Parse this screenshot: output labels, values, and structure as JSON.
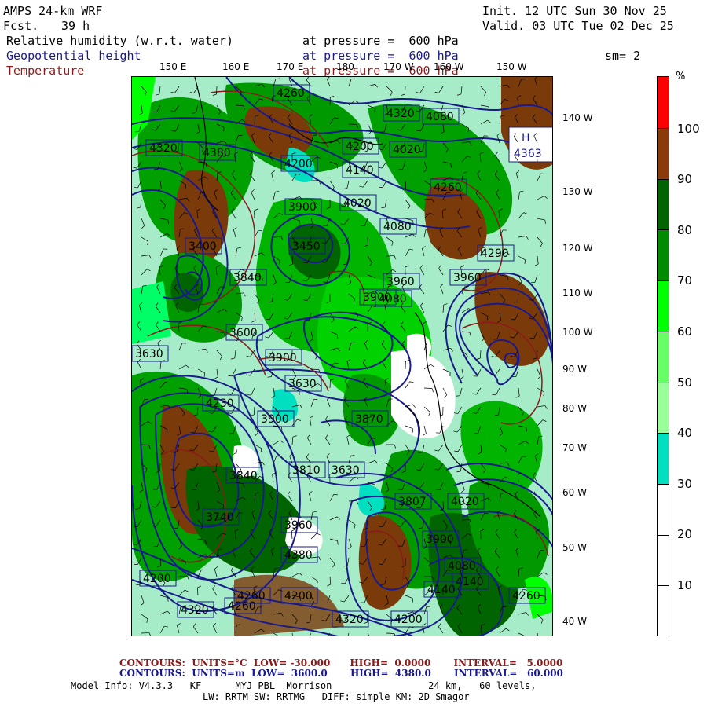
{
  "header": {
    "model": "AMPS 24-km WRF",
    "fcst_label": "Fcst.",
    "fcst_value": "39 h",
    "init": "Init. 12 UTC Sun 30 Nov 25",
    "valid": "Valid. 03 UTC Tue 02 Dec 25",
    "fields": [
      {
        "name": "Relative humidity (w.r.t. water)",
        "level": "at pressure =  600 hPa",
        "color": "#000000"
      },
      {
        "name": "Geopotential height",
        "level": "at pressure =  600 hPa",
        "color": "#1a1a8c"
      },
      {
        "name": "Temperature",
        "level": "at pressure =  600 hPa",
        "color": "#8b1a1a"
      }
    ],
    "smoothing": "sm= 2"
  },
  "axes": {
    "top_lon_labels": [
      "150 E",
      "160 E",
      "170 E",
      "180",
      "170 W",
      "160 W",
      "150 W"
    ],
    "right_lat_labels": [
      "140 W",
      "130 W",
      "120 W",
      "110 W",
      "100 W",
      "90 W",
      "80 W",
      "70 W",
      "60 W",
      "50 W",
      "40 W"
    ]
  },
  "map_labels": {
    "height_boxes": [
      "4320",
      "4380",
      "4260",
      "4200",
      "4140",
      "4020",
      "4080",
      "4363",
      "4320",
      "4200",
      "4290",
      "3900",
      "4020",
      "4080",
      "4260",
      "3400",
      "3450",
      "3960",
      "4080",
      "3840",
      "3960",
      "3900",
      "3630",
      "3600",
      "3900",
      "3630",
      "4230",
      "3900",
      "3870",
      "3840",
      "3810",
      "3630",
      "3740",
      "3807",
      "3960",
      "3900",
      "4080",
      "4140",
      "4140",
      "4320",
      "4380",
      "4200",
      "4260",
      "4260",
      "4200",
      "4320",
      "4200",
      "4260",
      "4020"
    ],
    "high_marker": "H",
    "high_value": "4363"
  },
  "colorbar": {
    "unit": "%",
    "ticks": [
      "100",
      "90",
      "80",
      "70",
      "60",
      "50",
      "40",
      "30",
      "20",
      "10"
    ],
    "segments": [
      {
        "color": "#ff0000"
      },
      {
        "color": "#8b3a0a"
      },
      {
        "color": "#006400"
      },
      {
        "color": "#008c00"
      },
      {
        "color": "#00ff00"
      },
      {
        "color": "#66ff66"
      },
      {
        "color": "#99ff99"
      },
      {
        "color": "#00e0c0"
      },
      {
        "color": "#ffffff"
      },
      {
        "color": "#ffffff"
      },
      {
        "color": "#ffffff"
      }
    ]
  },
  "footer": {
    "temp_contours": "CONTOURS:  UNITS=°C  LOW= -30.000      HIGH=  0.0000       INTERVAL=   5.0000",
    "temp_color": "#8b1a1a",
    "hgt_contours": "CONTOURS:  UNITS=m  LOW=  3600.0       HIGH=  4380.0       INTERVAL=   60.000",
    "hgt_color": "#1a1a8c",
    "model_info": "Model Info: V4.3.3   KF      MYJ PBL  Morrison                 24 km,   60 levels,",
    "model_info2": "LW: RRTM SW: RRTMG   DIFF: simple KM: 2D Smagor"
  }
}
